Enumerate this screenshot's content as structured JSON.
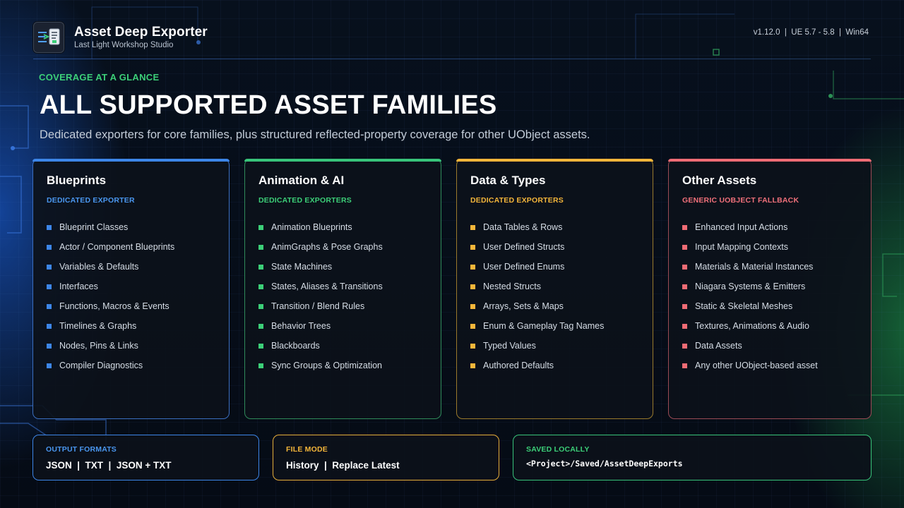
{
  "header": {
    "title": "Asset Deep Exporter",
    "subtitle": "Last Light Workshop Studio",
    "version_info": "v1.12.0  |  UE 5.7 - 5.8  |  Win64",
    "logo_icon": "export-document-icon"
  },
  "hero": {
    "eyebrow": "COVERAGE AT A GLANCE",
    "headline": "ALL SUPPORTED ASSET FAMILIES",
    "subhead": "Dedicated exporters for core families, plus structured reflected-property coverage for other UObject assets."
  },
  "cards": [
    {
      "title": "Blueprints",
      "tag": "DEDICATED EXPORTER",
      "accent": "#3d86e8",
      "items": [
        "Blueprint Classes",
        "Actor / Component Blueprints",
        "Variables & Defaults",
        "Interfaces",
        "Functions, Macros & Events",
        "Timelines & Graphs",
        "Nodes, Pins & Links",
        "Compiler Diagnostics"
      ]
    },
    {
      "title": "Animation & AI",
      "tag": "DEDICATED EXPORTERS",
      "accent": "#3ccf78",
      "items": [
        "Animation Blueprints",
        "AnimGraphs & Pose Graphs",
        "State Machines",
        "States, Aliases & Transitions",
        "Transition / Blend Rules",
        "Behavior Trees",
        "Blackboards",
        "Sync Groups & Optimization"
      ]
    },
    {
      "title": "Data & Types",
      "tag": "DEDICATED EXPORTERS",
      "accent": "#f5b63a",
      "items": [
        "Data Tables & Rows",
        "User Defined Structs",
        "User Defined Enums",
        "Nested Structs",
        "Arrays, Sets & Maps",
        "Enum & Gameplay Tag Names",
        "Typed Values",
        "Authored Defaults"
      ]
    },
    {
      "title": "Other Assets",
      "tag": "GENERIC UOBJECT FALLBACK",
      "accent": "#ef6c75",
      "items": [
        "Enhanced Input Actions",
        "Input Mapping Contexts",
        "Materials & Material Instances",
        "Niagara Systems & Emitters",
        "Static & Skeletal Meshes",
        "Textures, Animations & Audio",
        "Data Assets",
        "Any other UObject-based asset"
      ]
    }
  ],
  "footer": {
    "output_formats": {
      "label": "OUTPUT FORMATS",
      "value": "JSON  |  TXT  |  JSON + TXT"
    },
    "file_mode": {
      "label": "FILE MODE",
      "value": "History  |  Replace Latest"
    },
    "saved_locally": {
      "label": "SAVED LOCALLY",
      "value": "<Project>/Saved/AssetDeepExports"
    }
  }
}
